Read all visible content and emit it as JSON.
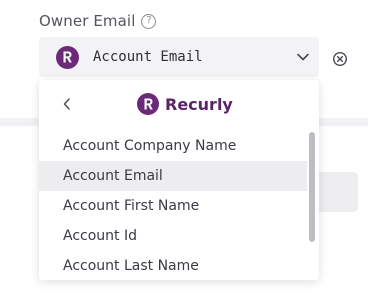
{
  "field": {
    "label": "Owner Email",
    "help_glyph": "?",
    "selected_value": "Account Email"
  },
  "dropdown": {
    "brand_name": "Recurly",
    "options": [
      {
        "label": "Account Company Name"
      },
      {
        "label": "Account Email",
        "selected": true
      },
      {
        "label": "Account First Name"
      },
      {
        "label": "Account Id"
      },
      {
        "label": "Account Last Name"
      }
    ]
  },
  "icons": {
    "help": "help-circle-icon",
    "logo": "recurly-logo-icon",
    "chevron": "chevron-down-icon",
    "clear": "clear-circle-icon",
    "back": "chevron-left-icon"
  },
  "colors": {
    "brand": "#6b2a78",
    "selected_row": "#ededf0",
    "select_bg": "#f3f3f5"
  }
}
